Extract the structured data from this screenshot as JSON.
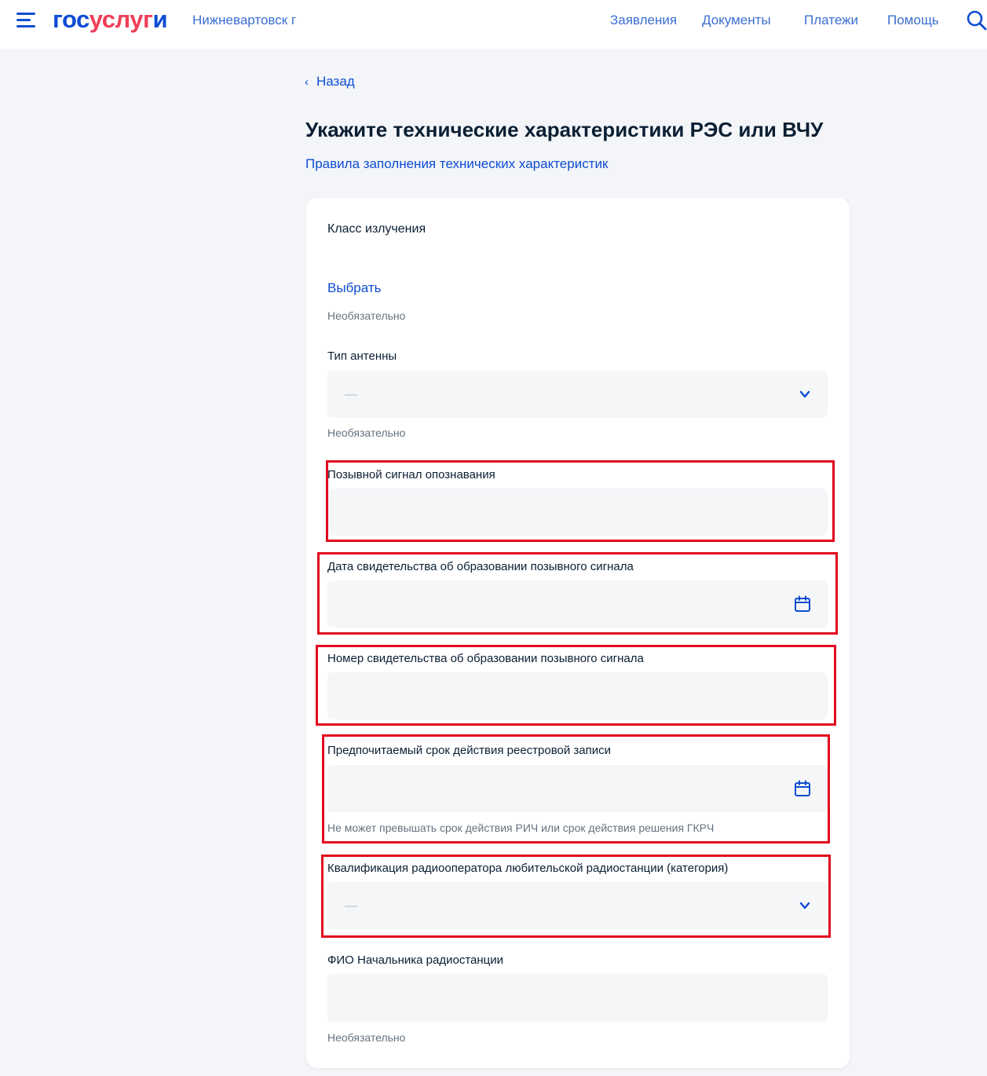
{
  "header": {
    "logo": {
      "part1": "гос",
      "part2": "услуг",
      "part3": "и"
    },
    "city": "Нижневартовск г",
    "nav": [
      "Заявления",
      "Документы",
      "Платежи",
      "Помощь"
    ],
    "icons": {
      "menu": "menu-icon",
      "search": "search-icon"
    }
  },
  "page": {
    "back_label": "Назад",
    "title": "Укажите технические характеристики РЭС или ВЧУ",
    "rules_link": "Правила заполнения технических характеристик"
  },
  "form": {
    "emission_class": {
      "label": "Класс излучения",
      "action": "Выбрать",
      "hint": "Необязательно"
    },
    "antenna_type": {
      "label": "Тип антенны",
      "value": "—",
      "hint": "Необязательно"
    },
    "callsign": {
      "label": "Позывной сигнал опознавания",
      "value": ""
    },
    "callsign_cert_date": {
      "label": "Дата свидетельства об образовании позывного сигнала",
      "value": ""
    },
    "callsign_cert_number": {
      "label": "Номер свидетельства об образовании позывного сигнала",
      "value": ""
    },
    "registry_term": {
      "label": "Предпочитаемый срок действия реестровой записи",
      "value": "",
      "hint": "Не может превышать срок действия РИЧ или срок действия решения ГКРЧ"
    },
    "operator_qualification": {
      "label": "Квалификация радиооператора любительской радиостанции (категория)",
      "value": "—"
    },
    "station_chief": {
      "label": "ФИО Начальника радиостанции",
      "value": "",
      "hint": "Необязательно"
    }
  },
  "colors": {
    "accent": "#0d4cd3",
    "logo_red": "#ee3f58",
    "highlight": "#e1081f",
    "field_bg": "#f5f6f8"
  }
}
